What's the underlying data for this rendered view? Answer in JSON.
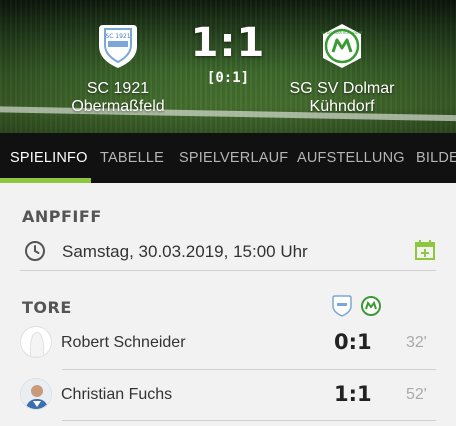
{
  "match": {
    "home": {
      "name_line1": "SC 1921",
      "name_line2": "Obermaßfeld",
      "badge_text": "SC 1921"
    },
    "away": {
      "name_line1": "SG SV Dolmar",
      "name_line2": "Kühndorf",
      "badge_text": "SV DOLMAR KÜHNDORF"
    },
    "score": "1:1",
    "halftime": "[0:1]"
  },
  "tabs": [
    {
      "label": "SPIELINFO",
      "active": true
    },
    {
      "label": "TABELLE"
    },
    {
      "label": "SPIELVERLAUF"
    },
    {
      "label": "AUFSTELLUNG"
    },
    {
      "label": "BILDE"
    }
  ],
  "kickoff": {
    "title": "ANPFIFF",
    "datetime": "Samstag, 30.03.2019, 15:00 Uhr",
    "clock_icon": "clock-icon",
    "calendar_icon": "calendar-add-icon"
  },
  "goals": {
    "title": "TORE",
    "items": [
      {
        "player": "Robert Schneider",
        "score": "0:1",
        "minute": "32'"
      },
      {
        "player": "Christian Fuchs",
        "score": "1:1",
        "minute": "52'"
      }
    ]
  },
  "colors": {
    "accent": "#8ec63f",
    "tab_bar": "#111111",
    "home_badge": "#6fa8dc",
    "away_badge": "#3a9b35"
  }
}
